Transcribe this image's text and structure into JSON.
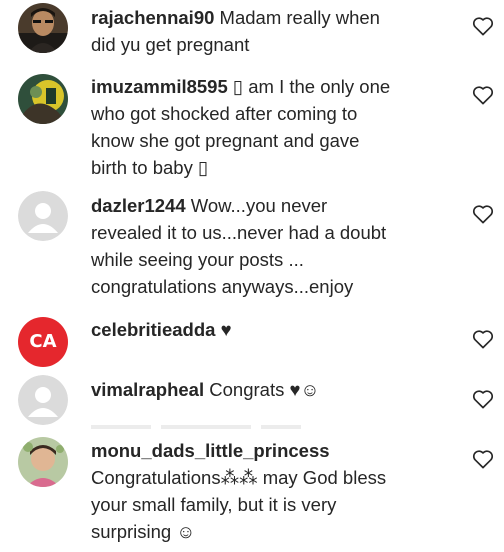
{
  "comments": [
    {
      "username": "rajachennai90",
      "text_lines": [
        "Madam really when",
        "did yu get pregnant"
      ]
    },
    {
      "username": "imuzammil8595",
      "text_lines": [
        "▯ am I the only one",
        "who got shocked after coming to",
        "know she got pregnant and gave",
        "birth to baby ▯"
      ]
    },
    {
      "username": "dazler1244",
      "text_lines": [
        "Wow...you never",
        "revealed it to us...never had a doubt",
        "while seeing your posts ...",
        "congratulations anyways...enjoy"
      ]
    },
    {
      "username": "celebritieadda",
      "text_lines": [
        "♥"
      ],
      "avatar_text": "CA"
    },
    {
      "username": "vimalrapheal",
      "text_lines": [
        "Congrats ♥☺"
      ]
    },
    {
      "username": "monu_dads_little_princess",
      "text_lines": [
        "Congratulations⁂⁂ may God bless",
        "your small family, but it is very",
        "surprising ☺"
      ]
    }
  ],
  "icons": {
    "like": "heart-outline-icon",
    "default_avatar": "person-silhouette-icon"
  },
  "colors": {
    "text": "#262626",
    "heart_stroke": "#262626",
    "default_avatar_bg": "#dbdbdb",
    "ca_avatar_bg": "#e5272d"
  }
}
